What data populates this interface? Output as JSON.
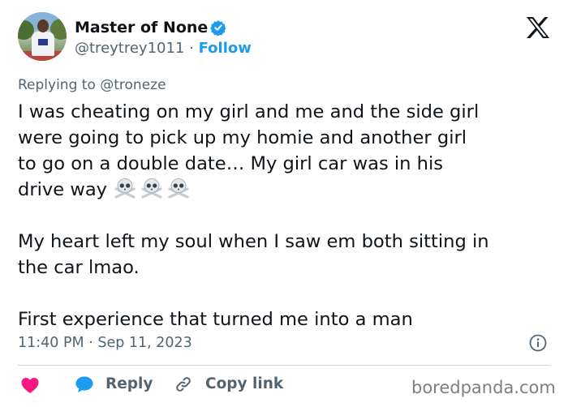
{
  "author": {
    "name": "Master of None",
    "handle": "@treytrey1011",
    "separator": "·",
    "follow_label": "Follow",
    "verified_icon": "verified-badge-icon",
    "verified_color": "#1d9bf0"
  },
  "platform_icon": "x-logo-icon",
  "reply_context": "Replying to @troneze",
  "tweet": {
    "paragraph1_lines": [
      "I was cheating on my girl and me and the side girl",
      "were going to pick up my homie and another girl",
      "to go on a double date… My girl car was in his",
      "drive way"
    ],
    "emoji": [
      "skull-crossbones-icon",
      "skull-crossbones-icon",
      "skull-crossbones-icon"
    ],
    "paragraph2_lines": [
      "My heart left my soul when I saw em both sitting in",
      "the car lmao."
    ],
    "paragraph3_lines": [
      "First experience that turned me into a man"
    ]
  },
  "timestamp": "11:40 PM · Sep 11, 2023",
  "actions": {
    "like_icon": "heart-icon",
    "like_color": "#f91880",
    "reply_label": "Reply",
    "reply_color": "#1d9bf0",
    "copy_link_label": "Copy link"
  },
  "watermark": "boredpanda.com"
}
